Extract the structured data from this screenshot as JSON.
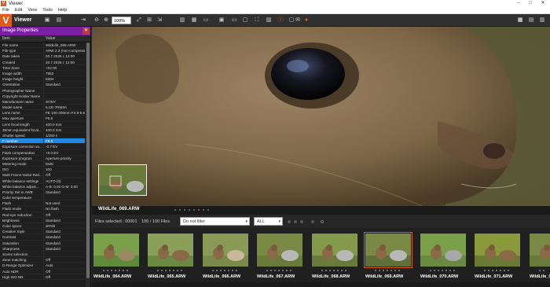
{
  "app": {
    "title": "Viewer",
    "icon_letter": "V"
  },
  "window_controls": [
    "–",
    "□",
    "✕"
  ],
  "menu": [
    "File",
    "Edit",
    "View",
    "Tools",
    "Help"
  ],
  "toolbar": {
    "title": "Viewer",
    "zoom": "100%"
  },
  "panel": {
    "title": "Image Properties",
    "close": "✕",
    "columns": [
      "Item",
      "Value"
    ],
    "rows": [
      [
        "File name",
        "WildLife_069.ARW"
      ],
      [
        "File type",
        "ARW 2.3 (non-compressed)"
      ],
      [
        "Date taken",
        "20.7.2025 г. 12:00"
      ],
      [
        "Created",
        "20.7.2025 г. 12:00"
      ],
      [
        "Time Zone",
        "+02:00"
      ],
      [
        "Image width",
        "7952"
      ],
      [
        "Image height",
        "5304"
      ],
      [
        "Orientation",
        "Standard"
      ],
      [
        "Photographer Name",
        ""
      ],
      [
        "Copyright Holder Name",
        ""
      ],
      [
        "Manufacturer name",
        "SONY"
      ],
      [
        "Model name",
        "ILCE-7RM3A"
      ],
      [
        "Lens name",
        "FE 100-400mm F4.5-5.6 GM OSS"
      ],
      [
        "Max aperture",
        "F5.6"
      ],
      [
        "Lens focal length",
        "400.0 mm"
      ],
      [
        "35mm equivalent focal...",
        "400.0 mm"
      ],
      [
        "Shutter speed",
        "1/250 s"
      ],
      [
        "F-number",
        "F6.3"
      ],
      [
        "Exposure correction va...",
        "-0.7 EV"
      ],
      [
        "Flash compensation",
        "+0.0 EV"
      ],
      [
        "Exposure program",
        "Aperture priority"
      ],
      [
        "Metering mode",
        "Multi"
      ],
      [
        "ISO",
        "100"
      ],
      [
        "Multi Frame Noise Red...",
        "Off"
      ],
      [
        "White balance settings",
        "AUTO (0)"
      ],
      [
        "White balance adjust...",
        "A-B: 0.00 G-M: 0.00"
      ],
      [
        "Priority Set in AWB",
        "Standard"
      ],
      [
        "Color temperature",
        ""
      ],
      [
        "Flash",
        "Not used"
      ],
      [
        "Flash mode",
        "No flash"
      ],
      [
        "Red-eye reduction",
        "Off"
      ],
      [
        "Brightness",
        "Standard"
      ],
      [
        "Color space",
        "sRGB"
      ],
      [
        "Creative Style",
        "Standard"
      ],
      [
        "Contrast",
        "Standard"
      ],
      [
        "Saturation",
        "Standard"
      ],
      [
        "Sharpness",
        "Standard"
      ],
      [
        "Scene selection",
        ""
      ],
      [
        "Zone matching",
        "Off"
      ],
      [
        "D-Range Optimizer",
        "Auto"
      ],
      [
        "Auto HDR",
        "Off"
      ],
      [
        "High ISO NR",
        "Off"
      ]
    ],
    "selected_row": 17
  },
  "viewer": {
    "caption": "WildLife_069.ARW"
  },
  "filterbar": {
    "selected_label": "Files selected : 00001",
    "count_label": "100 / 100 Files",
    "filter_value": "Do not filter",
    "type_value": "ALL"
  },
  "thumbnails": [
    {
      "name": "WildLife_064.ARW"
    },
    {
      "name": "WildLife_065.ARW"
    },
    {
      "name": "WildLife_066.ARW"
    },
    {
      "name": "WildLife_067.ARW"
    },
    {
      "name": "WildLife_068.ARW"
    },
    {
      "name": "WildLife_069.ARW"
    },
    {
      "name": "WildLife_070.ARW"
    },
    {
      "name": "WildLife_071.ARW"
    },
    {
      "name": "WildLife_07"
    }
  ],
  "colors": {
    "accent": "#e05a1a",
    "panel_header": "#7b1fa2",
    "selection": "#1e88e5"
  }
}
